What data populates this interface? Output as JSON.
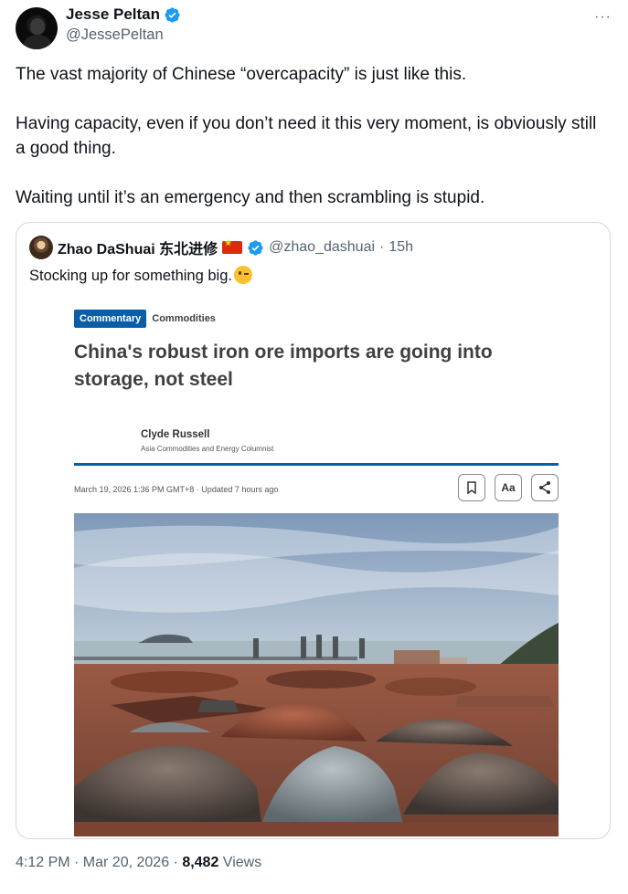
{
  "author": {
    "name": "Jesse Peltan",
    "handle": "@JessePeltan"
  },
  "more_label": "···",
  "tweet": {
    "paragraphs": [
      "The vast majority of Chinese “overcapacity” is just like this.",
      "Having capacity, even if you don’t need it this very moment, is obviously still a good thing.",
      "Waiting until it’s an emergency and then scrambling is stupid."
    ]
  },
  "quote": {
    "name": "Zhao DaShuai 东北进修",
    "handle": "@zhao_dashuai",
    "separator": "·",
    "time": "15h",
    "text": "Stocking up for something big.",
    "article": {
      "tag_primary": "Commentary",
      "tag_secondary": "Commodities",
      "headline": "China's robust iron ore imports are going into storage, not steel",
      "byline_name": "Clyde Russell",
      "byline_role": "Asia Commodities and Energy Columnist",
      "dateline": "March 19, 2026 1:36 PM GMT+8 · Updated 7 hours ago",
      "font_tool_label": "Aa"
    }
  },
  "footer": {
    "time": "4:12 PM · Mar 20, 2026 · ",
    "views_count": "8,482",
    "views_label": " Views"
  },
  "colors": {
    "verified": "#1d9bf0",
    "reuters_blue": "#0a5ea8",
    "muted": "#536471"
  },
  "icons": [
    "verified-badge-icon",
    "china-flag-icon",
    "winking-face-icon",
    "bookmark-icon",
    "share-icon"
  ]
}
